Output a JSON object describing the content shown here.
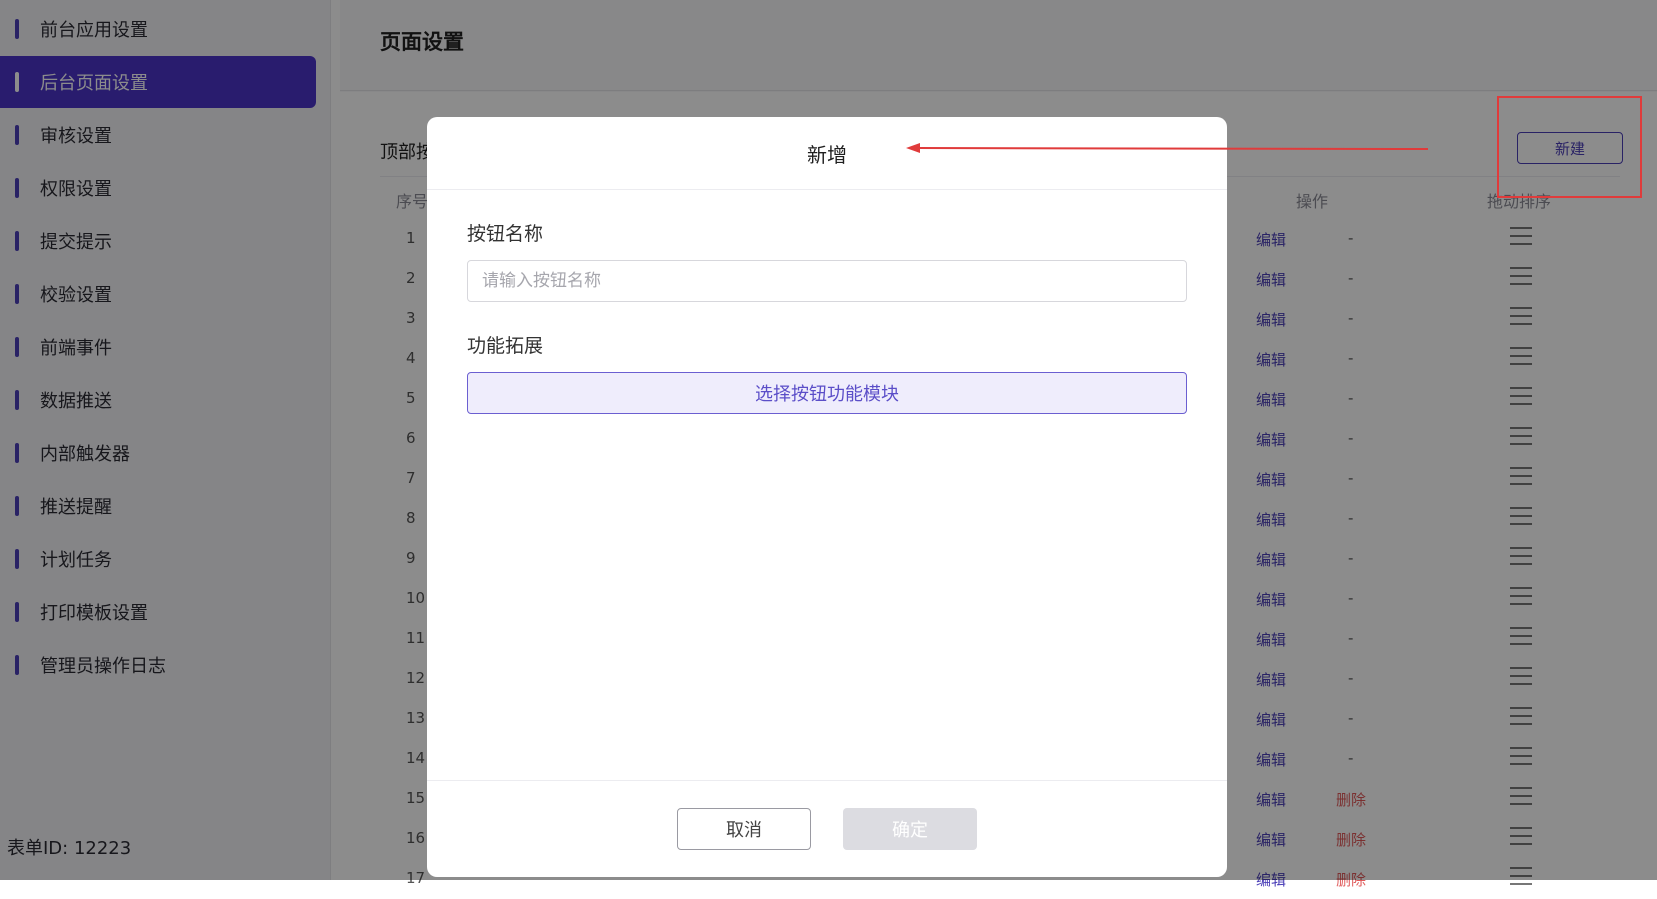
{
  "sidebar": {
    "items": [
      {
        "label": "前台应用设置",
        "active": false
      },
      {
        "label": "后台页面设置",
        "active": true
      },
      {
        "label": "审核设置",
        "active": false
      },
      {
        "label": "权限设置",
        "active": false
      },
      {
        "label": "提交提示",
        "active": false
      },
      {
        "label": "校验设置",
        "active": false
      },
      {
        "label": "前端事件",
        "active": false
      },
      {
        "label": "数据推送",
        "active": false
      },
      {
        "label": "内部触发器",
        "active": false
      },
      {
        "label": "推送提醒",
        "active": false
      },
      {
        "label": "计划任务",
        "active": false
      },
      {
        "label": "打印模板设置",
        "active": false
      },
      {
        "label": "管理员操作日志",
        "active": false
      }
    ],
    "form_id": "表单ID: 12223"
  },
  "main": {
    "page_title": "页面设置",
    "section_title": "顶部按",
    "new_button": "新建",
    "table": {
      "headers": {
        "index": "序号",
        "actions": "操作",
        "drag_sort": "拖动排序"
      },
      "rows": [
        {
          "index": "1",
          "edit": "编辑",
          "extra": "-"
        },
        {
          "index": "2",
          "edit": "编辑",
          "extra": "-"
        },
        {
          "index": "3",
          "edit": "编辑",
          "extra": "-"
        },
        {
          "index": "4",
          "edit": "编辑",
          "extra": "-"
        },
        {
          "index": "5",
          "edit": "编辑",
          "extra": "-"
        },
        {
          "index": "6",
          "edit": "编辑",
          "extra": "-"
        },
        {
          "index": "7",
          "edit": "编辑",
          "extra": "-"
        },
        {
          "index": "8",
          "edit": "编辑",
          "extra": "-"
        },
        {
          "index": "9",
          "edit": "编辑",
          "extra": "-"
        },
        {
          "index": "10",
          "edit": "编辑",
          "extra": "-"
        },
        {
          "index": "11",
          "edit": "编辑",
          "extra": "-"
        },
        {
          "index": "12",
          "edit": "编辑",
          "extra": "-"
        },
        {
          "index": "13",
          "edit": "编辑",
          "extra": "-"
        },
        {
          "index": "14",
          "edit": "编辑",
          "extra": "-"
        },
        {
          "index": "15",
          "edit": "编辑",
          "extra": "删除"
        },
        {
          "index": "16",
          "edit": "编辑",
          "extra": "删除"
        },
        {
          "index": "17",
          "edit": "编辑",
          "extra": "删除"
        }
      ]
    }
  },
  "modal": {
    "title": "新增",
    "button_name_label": "按钮名称",
    "button_name_placeholder": "请输入按钮名称",
    "button_name_value": "",
    "extension_label": "功能拓展",
    "select_module_button": "选择按钮功能模块",
    "cancel_button": "取消",
    "confirm_button": "确定"
  },
  "colors": {
    "accent": "#4b34c9",
    "annotation_red": "#e03b3b",
    "delete_red": "#e05a5a"
  }
}
